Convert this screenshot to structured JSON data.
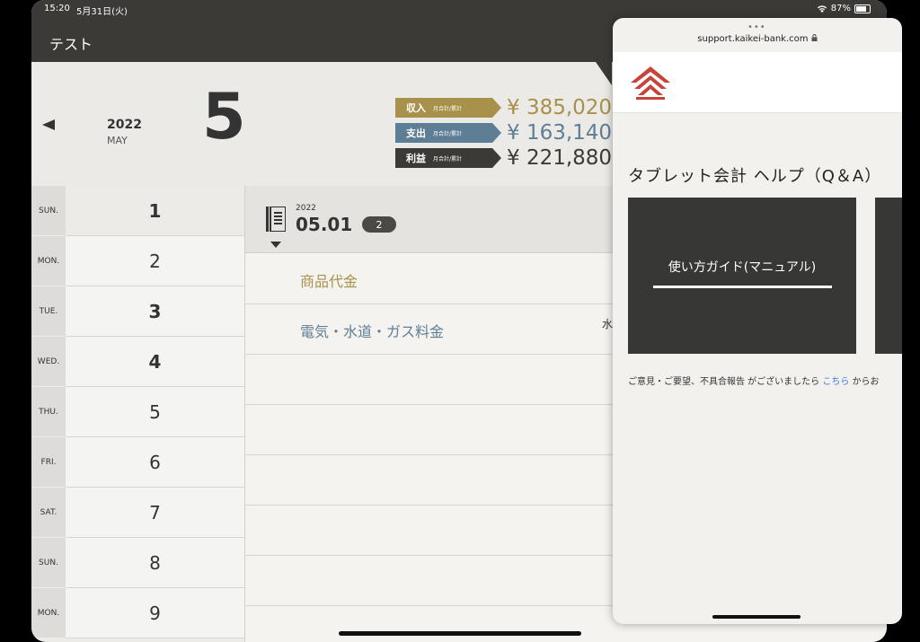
{
  "status": {
    "time": "15:20",
    "date": "5月31日(火)",
    "battery": "87%"
  },
  "app": {
    "title": "テスト"
  },
  "month": {
    "year": "2022",
    "month_name": "MAY",
    "month_number": "5"
  },
  "summary": {
    "sub_label": "月合計/累計",
    "income": {
      "label": "収入",
      "amount": "¥ 385,020",
      "color": "#a8914a"
    },
    "expense": {
      "label": "支出",
      "amount": "¥ 163,140",
      "color": "#5e7e96"
    },
    "profit": {
      "label": "利益",
      "amount": "¥ 221,880",
      "color": "#3b3a37"
    }
  },
  "days": [
    {
      "dow": "SUN.",
      "num": "1"
    },
    {
      "dow": "MON.",
      "num": "2"
    },
    {
      "dow": "TUE.",
      "num": "3"
    },
    {
      "dow": "WED.",
      "num": "4"
    },
    {
      "dow": "THU.",
      "num": "5"
    },
    {
      "dow": "FRI.",
      "num": "6"
    },
    {
      "dow": "SAT.",
      "num": "7"
    },
    {
      "dow": "SUN.",
      "num": "8"
    },
    {
      "dow": "MON.",
      "num": "9"
    }
  ],
  "detail": {
    "year": "2022",
    "date": "05.01",
    "count": "2",
    "entries": [
      {
        "label": "商品代金",
        "color": "#a8914a"
      },
      {
        "label": "電気・水道・ガス料金",
        "color": "#5e7e96",
        "extra": "水"
      }
    ]
  },
  "browser": {
    "url": "support.kaikei-bank.com",
    "heading": "タブレット会計 ヘルプ（Q＆A）",
    "card_label": "使い方ガイド(マニュアル)",
    "feedback_text": "ご意見・ご要望、不具合報告 がございましたら ",
    "feedback_link": "こちら",
    "feedback_tail": " からお"
  }
}
